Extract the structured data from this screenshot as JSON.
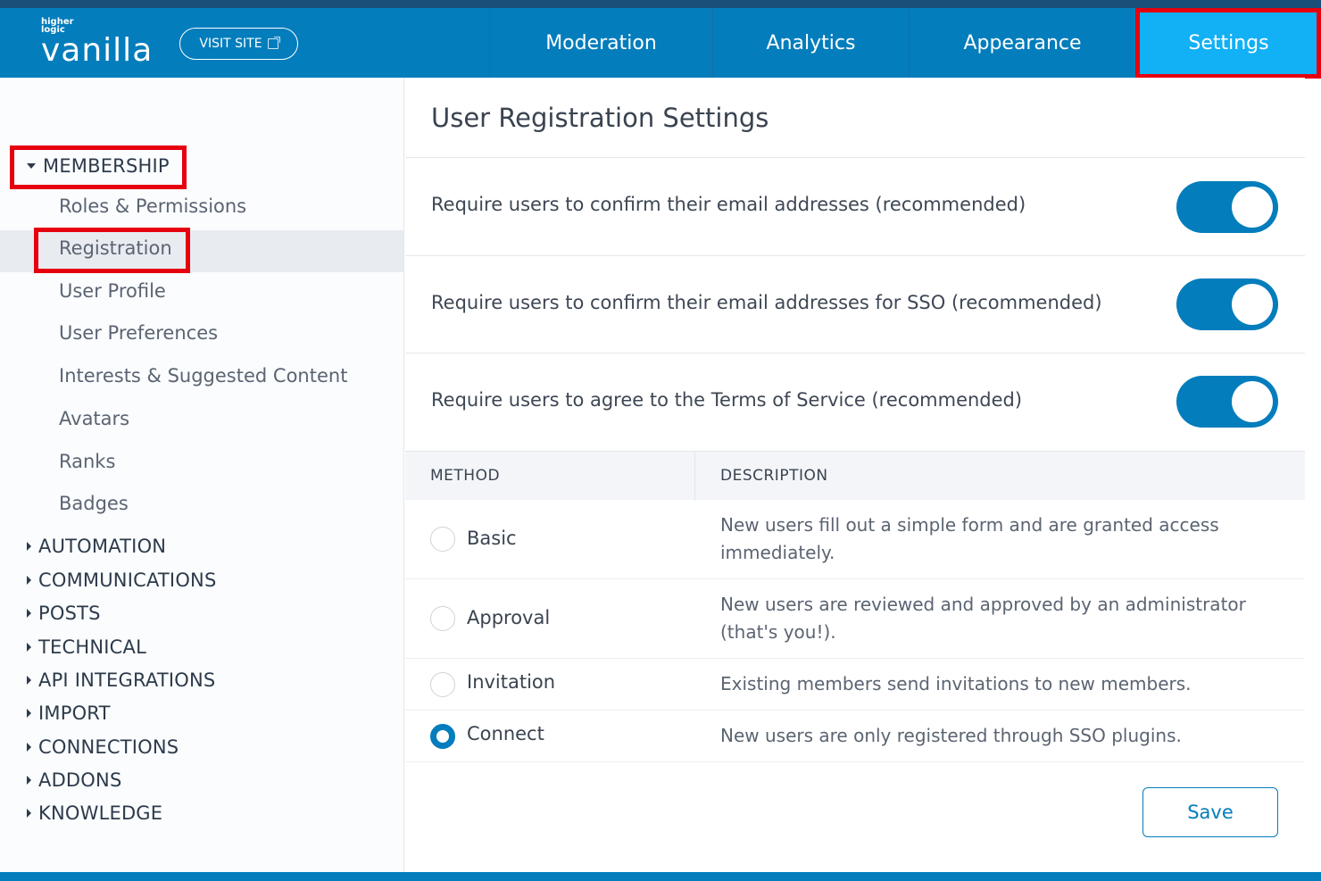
{
  "brand": {
    "top_text": "higher logic",
    "name": "vanilla"
  },
  "header": {
    "visit_site": "VISIT SITE",
    "nav": [
      {
        "label": "Moderation"
      },
      {
        "label": "Analytics"
      },
      {
        "label": "Appearance"
      },
      {
        "label": "Settings",
        "active": true
      }
    ]
  },
  "sidebar": {
    "membership": {
      "label": "MEMBERSHIP",
      "items": [
        "Roles & Permissions",
        "Registration",
        "User Profile",
        "User Preferences",
        "Interests & Suggested Content",
        "Avatars",
        "Ranks",
        "Badges"
      ]
    },
    "sections": [
      "AUTOMATION",
      "COMMUNICATIONS",
      "POSTS",
      "TECHNICAL",
      "API INTEGRATIONS",
      "IMPORT",
      "CONNECTIONS",
      "ADDONS",
      "KNOWLEDGE"
    ]
  },
  "main": {
    "title": "User Registration Settings",
    "toggles": [
      {
        "label": "Require users to confirm their email addresses (recommended)",
        "on": true
      },
      {
        "label": "Require users to confirm their email addresses for SSO (recommended)",
        "on": true
      },
      {
        "label": "Require users to agree to the Terms of Service (recommended)",
        "on": true
      }
    ],
    "table": {
      "headers": [
        "METHOD",
        "DESCRIPTION"
      ],
      "rows": [
        {
          "method": "Basic",
          "desc": "New users fill out a simple form and are granted access immediately.",
          "selected": false
        },
        {
          "method": "Approval",
          "desc": "New users are reviewed and approved by an administrator (that's you!).",
          "selected": false
        },
        {
          "method": "Invitation",
          "desc": "Existing members send invitations to new members.",
          "selected": false
        },
        {
          "method": "Connect",
          "desc": "New users are only registered through SSO plugins.",
          "selected": true
        }
      ]
    },
    "save_label": "Save"
  },
  "colors": {
    "primary": "#037dbc",
    "active_tab": "#12b0f5",
    "highlight": "#e6000f"
  }
}
